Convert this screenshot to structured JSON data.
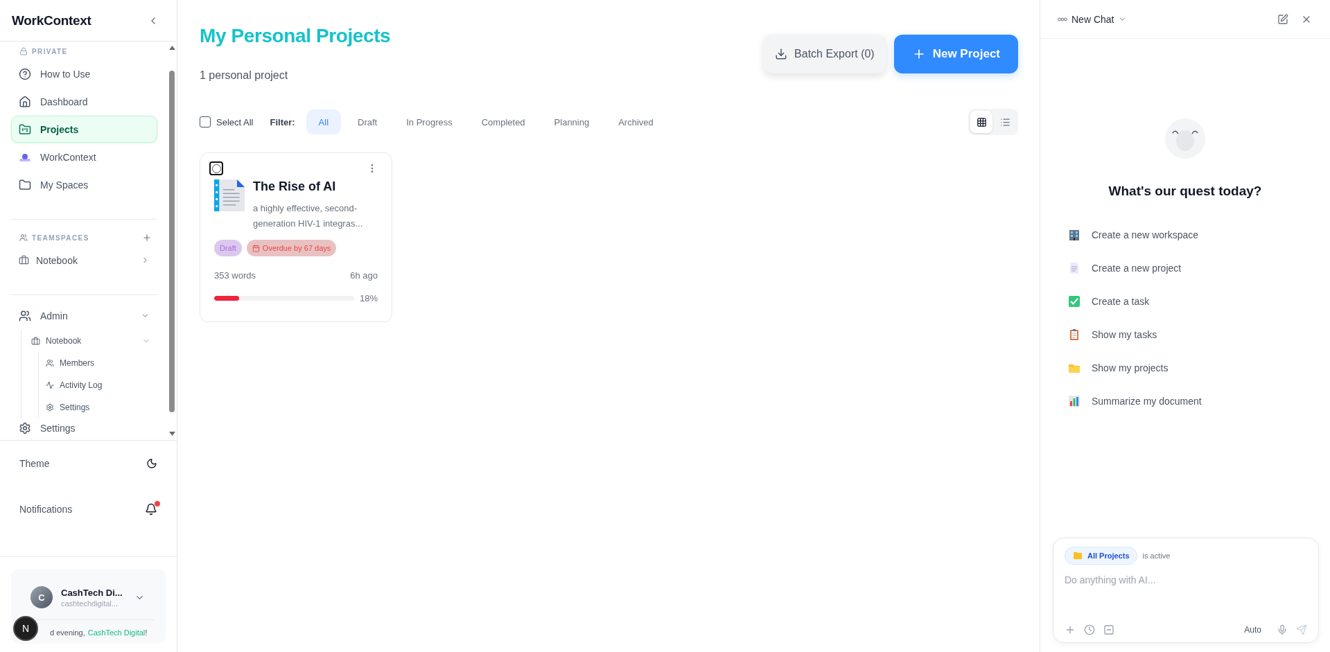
{
  "sidebar": {
    "brand": "WorkContext",
    "private": {
      "label": "PRIVATE",
      "items": [
        {
          "label": "How to Use",
          "selected": false
        },
        {
          "label": "Dashboard",
          "selected": false
        },
        {
          "label": "Projects",
          "selected": true
        },
        {
          "label": "WorkContext",
          "selected": false
        },
        {
          "label": "My Spaces",
          "selected": false
        }
      ]
    },
    "teamspaces": {
      "label": "TEAMSPACES",
      "items": [
        {
          "label": "Notebook",
          "expanded": false
        }
      ]
    },
    "admin": {
      "label": "Admin",
      "expanded": true,
      "children": [
        {
          "label": "Notebook",
          "expanded": true,
          "children": [
            {
              "label": "Members"
            },
            {
              "label": "Activity Log"
            },
            {
              "label": "Settings"
            }
          ]
        }
      ]
    },
    "settings_label": "Settings",
    "theme_label": "Theme",
    "notifications_label": "Notifications",
    "notifications_unread": true,
    "user": {
      "name": "CashTech Di...",
      "email": "cashtechdigital...",
      "avatar_initial": "C",
      "greeting": "d evening,",
      "greeting_name": "CashTech Digital",
      "greeting_end": "!"
    },
    "dev_badge": "N"
  },
  "main": {
    "title": "My Personal Projects",
    "subtitle": "1 personal project",
    "batch_export": "Batch Export (0)",
    "new_project": "New Project",
    "select_all": {
      "label": "Select All",
      "checked": false
    },
    "filter_label": "Filter:",
    "filters": [
      {
        "label": "All",
        "selected": true
      },
      {
        "label": "Draft",
        "selected": false
      },
      {
        "label": "In Progress",
        "selected": false
      },
      {
        "label": "Completed",
        "selected": false
      },
      {
        "label": "Planning",
        "selected": false
      },
      {
        "label": "Archived",
        "selected": false
      }
    ],
    "view_modes": [
      {
        "kind": "grid",
        "selected": true
      },
      {
        "kind": "list",
        "selected": false
      }
    ],
    "projects": [
      {
        "title": "The Rise of AI",
        "description": "a highly effective, second-generation HIV-1 integras...",
        "status": "Draft",
        "due": "Overdue by 67 days",
        "words": "353 words",
        "updated": "6h ago",
        "level": 0.18,
        "percent": "18%",
        "checked": false
      }
    ]
  },
  "chat": {
    "title": "New Chat",
    "heading": "What's our quest today?",
    "suggestions": [
      "Create a new workspace",
      "Create a new project",
      "Create a task",
      "Show my tasks",
      "Show my projects",
      "Summarize my document"
    ],
    "context": "All Projects",
    "context_note": "is active",
    "placeholder": "Do anything with AI...",
    "model": "Auto"
  }
}
